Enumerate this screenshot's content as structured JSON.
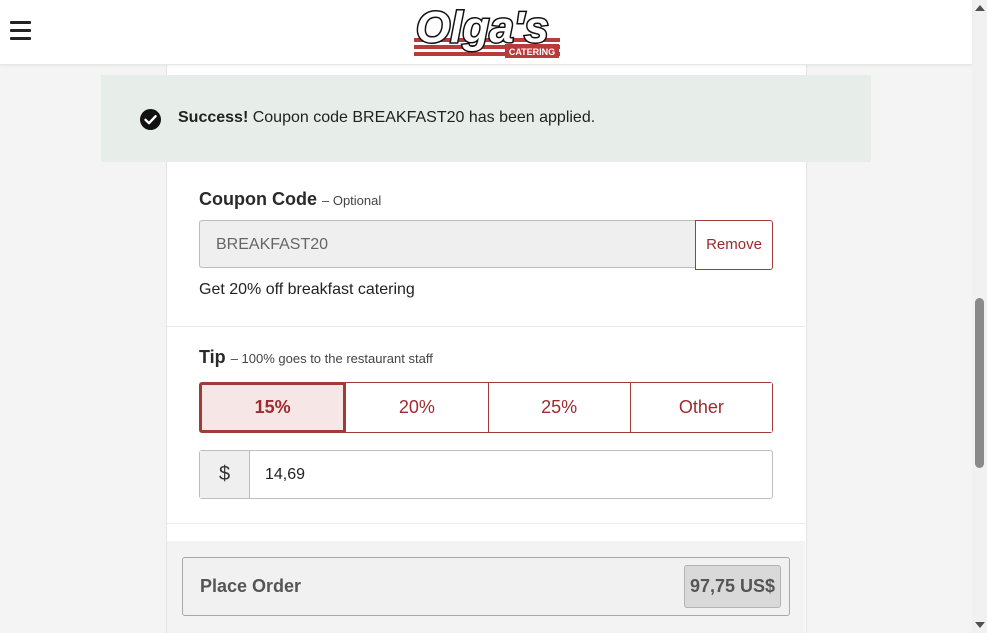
{
  "header": {
    "menu_icon": "hamburger-menu-icon",
    "logo_text": "Olga's",
    "logo_subtext": "CATERING"
  },
  "banner": {
    "icon": "check-circle-icon",
    "strong": "Success!",
    "message": "Coupon code BREAKFAST20 has been applied."
  },
  "coupon": {
    "title": "Coupon Code",
    "subtitle": "– Optional",
    "value": "BREAKFAST20",
    "remove_label": "Remove",
    "description": "Get 20% off breakfast catering"
  },
  "tip": {
    "title": "Tip",
    "subtitle": "– 100% goes to the restaurant staff",
    "options": [
      "15%",
      "20%",
      "25%",
      "Other"
    ],
    "selected": "15%",
    "currency_symbol": "$",
    "amount": "14,69"
  },
  "order": {
    "label": "Place Order",
    "total": "97,75 US$"
  },
  "colors": {
    "accent": "#a33a3a",
    "banner_bg": "#e7eee9"
  }
}
